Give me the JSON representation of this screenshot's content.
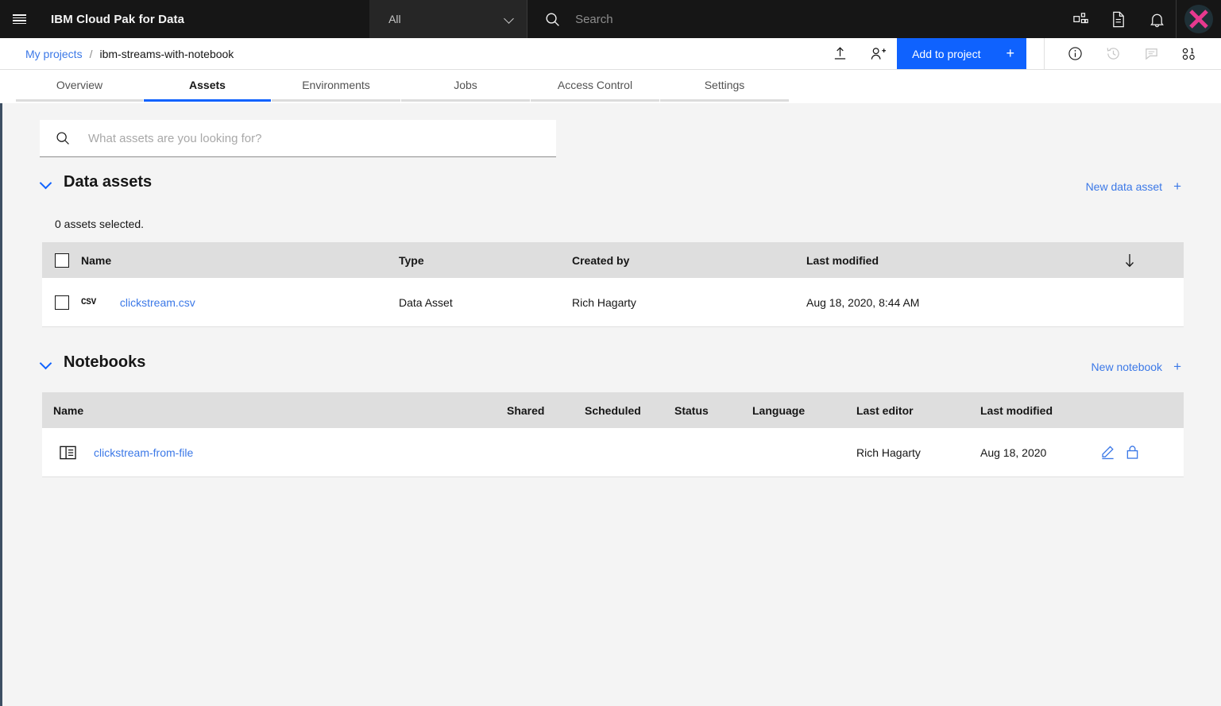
{
  "header": {
    "menu_icon": "hamburger-menu-icon",
    "brand": "IBM Cloud Pak for Data",
    "scope_select": {
      "value": "All",
      "icon": "chevron-down-icon"
    },
    "search": {
      "placeholder": "Search",
      "icon": "search-icon"
    },
    "icons": [
      "apps-grid-icon",
      "document-icon",
      "notification-bell-icon"
    ],
    "avatar": {
      "name": "avatar",
      "glyph": "x-mark",
      "color": "#e6398f",
      "bg": "#1f3037"
    }
  },
  "breadcrumb": {
    "parent": "My projects",
    "separator": "/",
    "current": "ibm-streams-with-notebook"
  },
  "actions": {
    "upload_icon": "upload-icon",
    "add_collaborator_icon": "add-user-icon",
    "add_to_project": {
      "label": "Add to project",
      "plus": "+",
      "color": "#0f62fe"
    },
    "right_icons": [
      "info-icon",
      "history-icon",
      "comment-icon",
      "data-points-icon"
    ]
  },
  "tabs": [
    {
      "label": "Overview",
      "active": false
    },
    {
      "label": "Assets",
      "active": true
    },
    {
      "label": "Environments",
      "active": false
    },
    {
      "label": "Jobs",
      "active": false
    },
    {
      "label": "Access Control",
      "active": false
    },
    {
      "label": "Settings",
      "active": false
    }
  ],
  "asset_search": {
    "placeholder": "What assets are you looking for?",
    "value": "",
    "icon": "search-icon"
  },
  "data_assets": {
    "title": "Data assets",
    "collapse_icon": "chevron-down-icon",
    "new_link": {
      "label": "New data asset",
      "plus": "+"
    },
    "selection_status": "0 assets selected.",
    "columns": [
      "Name",
      "Type",
      "Created by",
      "Last modified"
    ],
    "sort_icon": "sort-descending-arrow-icon",
    "rows": [
      {
        "icon": "csv-file-icon",
        "icon_label": "CSV",
        "name": "clickstream.csv",
        "type": "Data Asset",
        "created_by": "Rich Hagarty",
        "last_modified": "Aug 18, 2020, 8:44 AM"
      }
    ]
  },
  "notebooks": {
    "title": "Notebooks",
    "collapse_icon": "chevron-down-icon",
    "new_link": {
      "label": "New notebook",
      "plus": "+"
    },
    "columns": [
      "Name",
      "Shared",
      "Scheduled",
      "Status",
      "Language",
      "Last editor",
      "Last modified"
    ],
    "rows": [
      {
        "icon": "notebook-icon",
        "name": "clickstream-from-file",
        "shared": "",
        "scheduled": "",
        "status": "",
        "language": "",
        "last_editor": "Rich Hagarty",
        "last_modified": "Aug 18, 2020",
        "actions": [
          "edit-pencil-icon",
          "lock-icon"
        ]
      }
    ]
  }
}
